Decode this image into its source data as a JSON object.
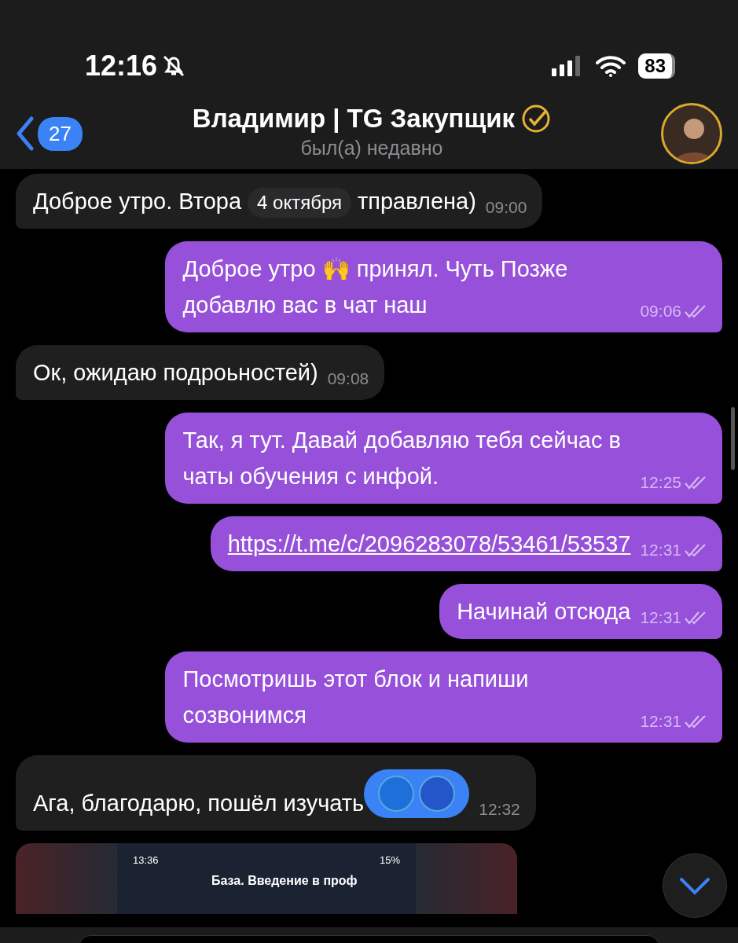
{
  "status_bar": {
    "time": "12:16",
    "muted": true,
    "battery": "83"
  },
  "header": {
    "back_count": "27",
    "title": "Владимир | TG Закупщик",
    "verified": true,
    "subtitle": "был(а) недавно"
  },
  "date_badge": "4 октября",
  "messages": [
    {
      "outgoing": false,
      "kind": "text",
      "parts": [
        "Доброе утро. Втора",
        "тправлена)"
      ],
      "time": "09:00"
    },
    {
      "outgoing": true,
      "kind": "text",
      "parts": [
        "Доброе утро 🙌 принял. Чуть Позже добавлю вас в чат наш"
      ],
      "time": "09:06",
      "read": true
    },
    {
      "outgoing": false,
      "kind": "text",
      "parts": [
        "Ок, ожидаю подроьностей)"
      ],
      "time": "09:08"
    },
    {
      "outgoing": true,
      "kind": "text",
      "parts": [
        "Так, я тут. Давай добавляю тебя сейчас в чаты обучения с инфой."
      ],
      "time": "12:25",
      "read": true
    },
    {
      "outgoing": true,
      "kind": "link",
      "parts": [
        "https://t.me/c/2096283078/53461/53537"
      ],
      "time": "12:31",
      "read": true
    },
    {
      "outgoing": true,
      "kind": "text",
      "parts": [
        "Начинай отсюда"
      ],
      "time": "12:31",
      "read": true
    },
    {
      "outgoing": true,
      "kind": "text",
      "parts": [
        "Посмотришь этот блок и напиши созвонимся"
      ],
      "time": "12:31",
      "read": true
    },
    {
      "outgoing": false,
      "kind": "text",
      "parts": [
        "Ага, благодарю, пошёл изучать"
      ],
      "time": "12:32",
      "reaction": {
        "selected": true
      }
    },
    {
      "outgoing": false,
      "kind": "screenshot",
      "shot": {
        "time": "13:36",
        "battery": "15%",
        "title": "База. Введение в проф"
      }
    }
  ]
}
